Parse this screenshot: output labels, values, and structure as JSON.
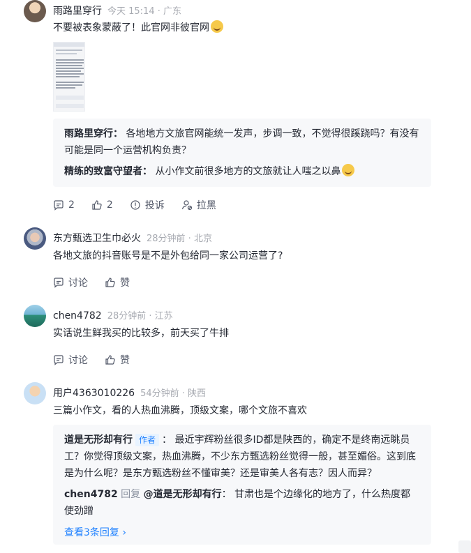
{
  "comments": [
    {
      "user": "雨路里穿行",
      "meta": "今天 15:14 · 广东",
      "text": "不要被表象蒙蔽了！此官网非彼官网",
      "replies": [
        {
          "name": "雨路里穿行：",
          "text": "各地地方文旅官网能统一发声，步调一致，不觉得很蹊跷吗？有没有可能是同一个运营机构负责？"
        },
        {
          "name": "精练的致富守望者：",
          "text": "从小作文前很多地方的文旅就让人嗤之以鼻"
        }
      ],
      "actions": {
        "comment": "2",
        "like": "2",
        "report": "投诉",
        "block": "拉黑"
      }
    },
    {
      "user": "东方甄选卫生巾必火",
      "meta": "28分钟前 · 北京",
      "text": "各地文旅的抖音账号是不是外包给同一家公司运营了?",
      "actions": {
        "comment": "讨论",
        "like": "赞"
      }
    },
    {
      "user": "chen4782",
      "meta": "28分钟前 · 江苏",
      "text": "实话说生鲜我买的比较多，前天买了牛排",
      "actions": {
        "comment": "讨论",
        "like": "赞"
      }
    },
    {
      "user": "用户4363010226",
      "meta": "54分钟前 · 陕西",
      "text": "三篇小作文，看的人热血沸腾，顶级文案，哪个文旅不喜欢",
      "replies": [
        {
          "name": "道是无形却有行",
          "tag": "作者",
          "sep": "：",
          "text": "最近宇辉粉丝很多ID都是陕西的，确定不是终南远眺员工？你觉得顶级文案，热血沸腾，不少东方甄选粉丝觉得一般，甚至媚俗。这到底是为什么呢？是东方甄选粉丝不懂审美？还是审美人各有志？因人而异？"
        },
        {
          "name": "chen4782",
          "reply_word": "回复",
          "target": "@道是无形却有行",
          "sep": "：",
          "text": "甘肃也是个边缘化的地方了，什么热度都使劲蹭"
        }
      ],
      "more": "查看3条回复"
    }
  ]
}
